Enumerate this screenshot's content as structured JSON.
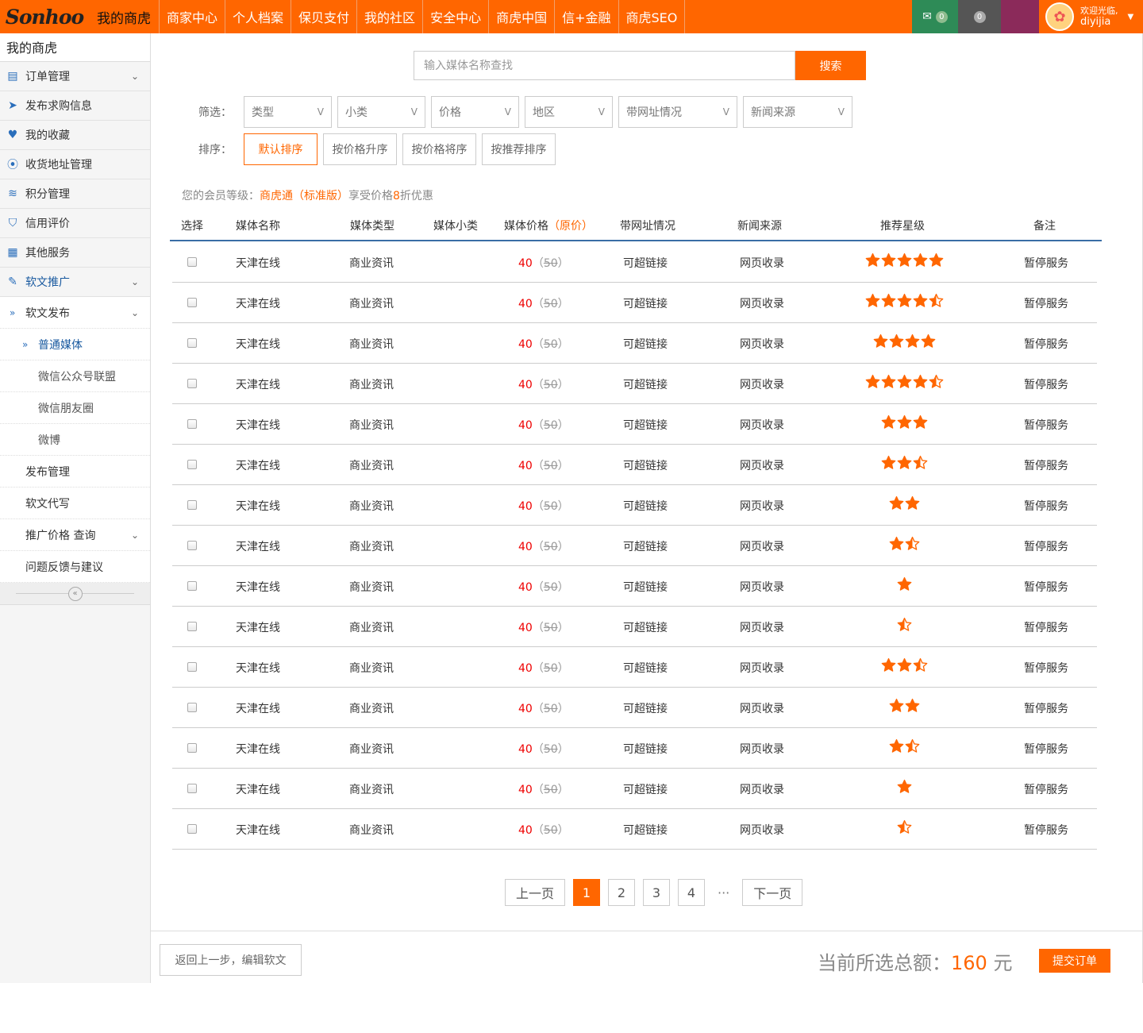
{
  "header": {
    "logo": "Sonhoo",
    "site_title": "我的商虎",
    "nav": [
      "商家中心",
      "个人档案",
      "保贝支付",
      "我的社区",
      "安全中心",
      "商虎中国",
      "信+金融",
      "商虎SEO"
    ],
    "mail_count": "0",
    "msg_count": "0",
    "welcome": "欢迎光临,",
    "username": "diyijia"
  },
  "sidebar": {
    "title": "我的商虎",
    "items": [
      "订单管理",
      "发布求购信息",
      "我的收藏",
      "收货地址管理",
      "积分管理",
      "信用评价",
      "其他服务",
      "软文推广"
    ],
    "sub_items": {
      "release": "软文发布",
      "normal_media": "普通媒体",
      "wechat_union": "微信公众号联盟",
      "wechat_moments": "微信朋友圈",
      "weibo": "微博",
      "publish_manage": "发布管理",
      "ghostwrite": "软文代写",
      "price_query": "推广价格 查询",
      "feedback": "问题反馈与建议"
    }
  },
  "search": {
    "placeholder": "输入媒体名称查找",
    "button": "搜索"
  },
  "filters": {
    "label": "筛选：",
    "options": [
      "类型",
      "小类",
      "价格",
      "地区",
      "带网址情况",
      "新闻来源"
    ]
  },
  "sort": {
    "label": "排序：",
    "options": [
      "默认排序",
      "按价格升序",
      "按价格将序",
      "按推荐排序"
    ]
  },
  "member": {
    "prefix": "您的会员等级：",
    "level": "商虎通（标准版）",
    "mid": "享受价格",
    "discount": "8",
    "suffix": "折优惠"
  },
  "table": {
    "headers": {
      "select": "选择",
      "name": "媒体名称",
      "type": "媒体类型",
      "subtype": "媒体小类",
      "price": "媒体价格",
      "price_sub": "（原价）",
      "url": "带网址情况",
      "source": "新闻来源",
      "stars": "推荐星级",
      "note": "备注"
    },
    "rows": [
      {
        "name": "天津在线",
        "type": "商业资讯",
        "price": "40",
        "orig": "50",
        "url": "可超链接",
        "source": "网页收录",
        "rating": 5,
        "note": "暂停服务"
      },
      {
        "name": "天津在线",
        "type": "商业资讯",
        "price": "40",
        "orig": "50",
        "url": "可超链接",
        "source": "网页收录",
        "rating": 4.5,
        "note": "暂停服务"
      },
      {
        "name": "天津在线",
        "type": "商业资讯",
        "price": "40",
        "orig": "50",
        "url": "可超链接",
        "source": "网页收录",
        "rating": 4,
        "note": "暂停服务"
      },
      {
        "name": "天津在线",
        "type": "商业资讯",
        "price": "40",
        "orig": "50",
        "url": "可超链接",
        "source": "网页收录",
        "rating": 4.5,
        "note": "暂停服务"
      },
      {
        "name": "天津在线",
        "type": "商业资讯",
        "price": "40",
        "orig": "50",
        "url": "可超链接",
        "source": "网页收录",
        "rating": 3,
        "note": "暂停服务"
      },
      {
        "name": "天津在线",
        "type": "商业资讯",
        "price": "40",
        "orig": "50",
        "url": "可超链接",
        "source": "网页收录",
        "rating": 2.5,
        "note": "暂停服务"
      },
      {
        "name": "天津在线",
        "type": "商业资讯",
        "price": "40",
        "orig": "50",
        "url": "可超链接",
        "source": "网页收录",
        "rating": 2,
        "note": "暂停服务"
      },
      {
        "name": "天津在线",
        "type": "商业资讯",
        "price": "40",
        "orig": "50",
        "url": "可超链接",
        "source": "网页收录",
        "rating": 1.5,
        "note": "暂停服务"
      },
      {
        "name": "天津在线",
        "type": "商业资讯",
        "price": "40",
        "orig": "50",
        "url": "可超链接",
        "source": "网页收录",
        "rating": 1,
        "note": "暂停服务"
      },
      {
        "name": "天津在线",
        "type": "商业资讯",
        "price": "40",
        "orig": "50",
        "url": "可超链接",
        "source": "网页收录",
        "rating": 0.5,
        "note": "暂停服务"
      },
      {
        "name": "天津在线",
        "type": "商业资讯",
        "price": "40",
        "orig": "50",
        "url": "可超链接",
        "source": "网页收录",
        "rating": 2.5,
        "note": "暂停服务"
      },
      {
        "name": "天津在线",
        "type": "商业资讯",
        "price": "40",
        "orig": "50",
        "url": "可超链接",
        "source": "网页收录",
        "rating": 2,
        "note": "暂停服务"
      },
      {
        "name": "天津在线",
        "type": "商业资讯",
        "price": "40",
        "orig": "50",
        "url": "可超链接",
        "source": "网页收录",
        "rating": 1.5,
        "note": "暂停服务"
      },
      {
        "name": "天津在线",
        "type": "商业资讯",
        "price": "40",
        "orig": "50",
        "url": "可超链接",
        "source": "网页收录",
        "rating": 1,
        "note": "暂停服务"
      },
      {
        "name": "天津在线",
        "type": "商业资讯",
        "price": "40",
        "orig": "50",
        "url": "可超链接",
        "source": "网页收录",
        "rating": 0.5,
        "note": "暂停服务"
      }
    ]
  },
  "pagination": {
    "prev": "上一页",
    "pages": [
      "1",
      "2",
      "3",
      "4"
    ],
    "current": "1",
    "dots": "···",
    "next": "下一页"
  },
  "footer": {
    "back": "返回上一步，编辑软文",
    "total_label": "当前所选总额：",
    "total_amount": "160",
    "total_unit": "元",
    "submit": "提交订单"
  },
  "colors": {
    "accent": "#ff6600",
    "link_blue": "#2a6ebb",
    "price_red": "#e00000"
  }
}
